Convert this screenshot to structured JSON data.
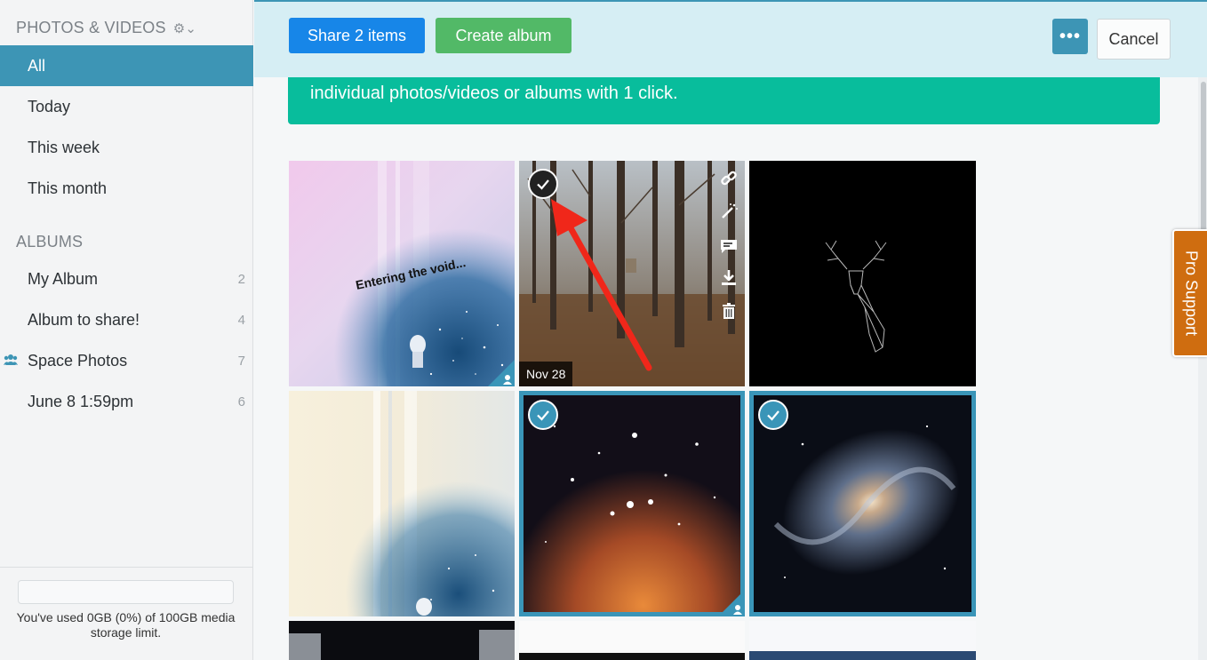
{
  "sidebar": {
    "photos_header": "PHOTOS & VIDEOS",
    "photos_items": [
      {
        "label": "All",
        "active": true
      },
      {
        "label": "Today"
      },
      {
        "label": "This week"
      },
      {
        "label": "This month"
      }
    ],
    "albums_header": "ALBUMS",
    "albums": [
      {
        "label": "My Album",
        "count": "2"
      },
      {
        "label": "Album to share!",
        "count": "4"
      },
      {
        "label": "Space Photos",
        "count": "7",
        "shared": true
      },
      {
        "label": "June 8 1:59pm",
        "count": "6"
      }
    ],
    "storage_text": "You've used 0GB (0%) of 100GB media storage limit."
  },
  "toolbar": {
    "share_label": "Share 2 items",
    "create_album_label": "Create album",
    "more_label": "•••",
    "cancel_label": "Cancel"
  },
  "banner": {
    "text": "individual photos/videos or albums with 1 click."
  },
  "pro_support": {
    "label": "Pro Support"
  },
  "grid": {
    "tiles": [
      {
        "name": "entering-the-void",
        "overlay_text": "Entering the void...",
        "selected": false
      },
      {
        "name": "forest-photo",
        "date": "Nov 28",
        "selected": false,
        "hover": true
      },
      {
        "name": "deer-photo",
        "selected": false
      },
      {
        "name": "light-leak-photo",
        "selected": false
      },
      {
        "name": "star-cluster-photo",
        "selected": true
      },
      {
        "name": "spiral-galaxy-photo",
        "selected": true
      }
    ]
  },
  "colors": {
    "accent": "#3d95b5",
    "share_button": "#1786e8",
    "create_album_button": "#52b967",
    "banner": "#08bd9c",
    "pro_support": "#cf6d10",
    "annotation_arrow": "#f0271a"
  }
}
